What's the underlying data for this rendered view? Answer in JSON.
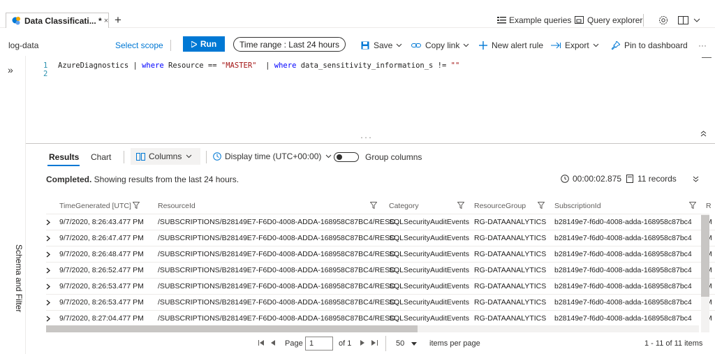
{
  "tabbar": {
    "tab_title": "Data Classificati... *",
    "close_glyph": "×",
    "add_glyph": "+",
    "example_queries": "Example queries",
    "query_explorer": "Query explorer"
  },
  "command_bar": {
    "workspace": "log-data",
    "select_scope": "Select scope",
    "run": "Run",
    "time_range": "Time range : Last 24 hours",
    "save": "Save",
    "copy_link": "Copy link",
    "new_alert_rule": "New alert rule",
    "export": "Export",
    "pin_to_dashboard": "Pin to dashboard",
    "more": "···"
  },
  "sidebar": {
    "expand": "»",
    "schema_label": "Schema and Filter"
  },
  "editor": {
    "lines": [
      {
        "num": "1",
        "parts": [
          {
            "t": "AzureDiagnostics | ",
            "c": "plain"
          },
          {
            "t": "where",
            "c": "kw"
          },
          {
            "t": " Resource == ",
            "c": "plain"
          },
          {
            "t": "\"MASTER\"",
            "c": "str"
          },
          {
            "t": "  | ",
            "c": "plain"
          },
          {
            "t": "where",
            "c": "kw"
          },
          {
            "t": " data_sensitivity_information_s != ",
            "c": "plain"
          },
          {
            "t": "\"\"",
            "c": "str"
          }
        ]
      },
      {
        "num": "2",
        "parts": []
      }
    ],
    "splitter": "...",
    "collapse": "≈"
  },
  "results": {
    "tab_results": "Results",
    "tab_chart": "Chart",
    "columns": "Columns",
    "display_time": "Display time (UTC+00:00)",
    "group_columns": "Group columns",
    "status_bold": "Completed.",
    "status_text": " Showing results from the last 24 hours.",
    "duration": "00:00:02.875",
    "records": "11 records",
    "headers": [
      "TimeGenerated [UTC]",
      "ResourceId",
      "Category",
      "ResourceGroup",
      "SubscriptionId",
      "R"
    ],
    "rows": [
      [
        "9/7/2020, 8:26:43.477 PM",
        "/SUBSCRIPTIONS/B28149E7-F6D0-4008-ADDA-168958C87BC4/RESO...",
        "SQLSecurityAuditEvents",
        "RG-DATAANALYTICS",
        "b28149e7-f6d0-4008-adda-168958c87bc4",
        "M"
      ],
      [
        "9/7/2020, 8:26:47.477 PM",
        "/SUBSCRIPTIONS/B28149E7-F6D0-4008-ADDA-168958C87BC4/RESO...",
        "SQLSecurityAuditEvents",
        "RG-DATAANALYTICS",
        "b28149e7-f6d0-4008-adda-168958c87bc4",
        "M"
      ],
      [
        "9/7/2020, 8:26:48.477 PM",
        "/SUBSCRIPTIONS/B28149E7-F6D0-4008-ADDA-168958C87BC4/RESO...",
        "SQLSecurityAuditEvents",
        "RG-DATAANALYTICS",
        "b28149e7-f6d0-4008-adda-168958c87bc4",
        "M"
      ],
      [
        "9/7/2020, 8:26:52.477 PM",
        "/SUBSCRIPTIONS/B28149E7-F6D0-4008-ADDA-168958C87BC4/RESO...",
        "SQLSecurityAuditEvents",
        "RG-DATAANALYTICS",
        "b28149e7-f6d0-4008-adda-168958c87bc4",
        "M"
      ],
      [
        "9/7/2020, 8:26:53.477 PM",
        "/SUBSCRIPTIONS/B28149E7-F6D0-4008-ADDA-168958C87BC4/RESO...",
        "SQLSecurityAuditEvents",
        "RG-DATAANALYTICS",
        "b28149e7-f6d0-4008-adda-168958c87bc4",
        "M"
      ],
      [
        "9/7/2020, 8:26:53.477 PM",
        "/SUBSCRIPTIONS/B28149E7-F6D0-4008-ADDA-168958C87BC4/RESO...",
        "SQLSecurityAuditEvents",
        "RG-DATAANALYTICS",
        "b28149e7-f6d0-4008-adda-168958c87bc4",
        "M"
      ],
      [
        "9/7/2020, 8:27:04.477 PM",
        "/SUBSCRIPTIONS/B28149E7-F6D0-4008-ADDA-168958C87BC4/RESO...",
        "SQLSecurityAuditEvents",
        "RG-DATAANALYTICS",
        "b28149e7-f6d0-4008-adda-168958c87bc4",
        "M"
      ]
    ]
  },
  "pager": {
    "page_label": "Page",
    "page_value": "1",
    "of_label": "of 1",
    "page_size": "50",
    "items_per_page": "items per page",
    "range": "1 - 11 of 11 items"
  },
  "colors": {
    "accent": "#0078d4",
    "keyword": "#0000ff",
    "string": "#a31515",
    "line_number": "#2b91af"
  }
}
